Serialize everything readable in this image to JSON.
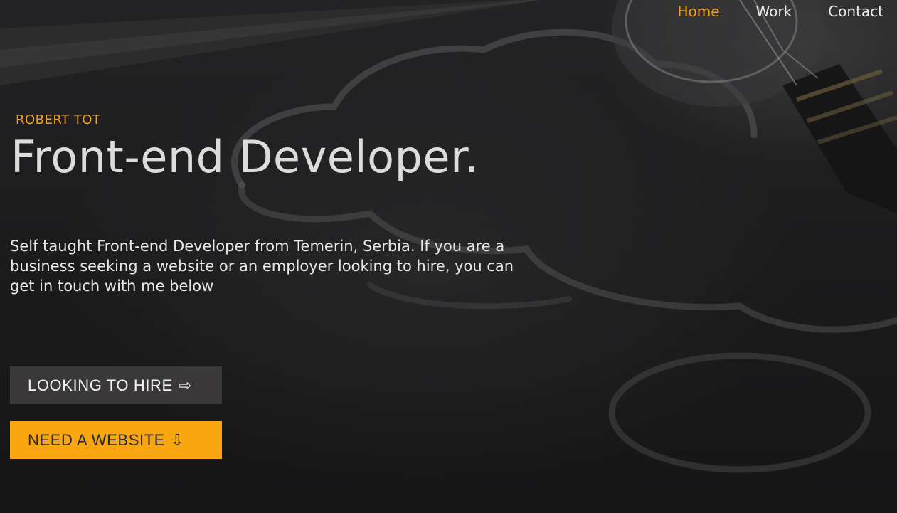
{
  "nav": {
    "items": [
      {
        "label": "Home",
        "active": true
      },
      {
        "label": "Work",
        "active": false
      },
      {
        "label": "Contact",
        "active": false
      }
    ]
  },
  "hero": {
    "kicker": "ROBERT TOT",
    "title": "Front-end Developer.",
    "intro": "Self taught Front-end Developer from Temerin, Serbia. If you are a business seeking a website or an employer looking to hire, you can get in touch with me below",
    "buttons": {
      "hire_label": "LOOKING TO HIRE",
      "hire_icon": "⇨",
      "website_label": "NEED A WEBSITE",
      "website_icon": "⇩"
    }
  },
  "colors": {
    "accent": "#f9a50f",
    "background": "#1b1b1c",
    "secondary_button": "#3a3839"
  },
  "icons": {
    "hire_arrow": "arrow-right-icon",
    "website_arrow": "arrow-down-icon"
  }
}
